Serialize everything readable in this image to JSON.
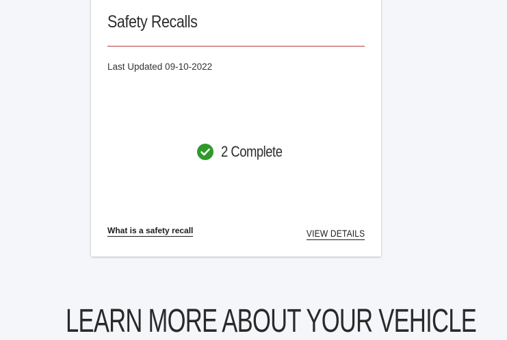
{
  "card": {
    "title": "Safety Recalls",
    "last_updated": "Last Updated 09-10-2022",
    "status": {
      "icon": "check-circle-icon",
      "icon_color": "#2e9a2a",
      "text": "2 Complete"
    },
    "recall_link": "What is a safety recall",
    "details_link": "VIEW DETAILS",
    "divider_color": "#b23a3a"
  },
  "section": {
    "heading": "LEARN MORE ABOUT YOUR VEHICLE"
  }
}
